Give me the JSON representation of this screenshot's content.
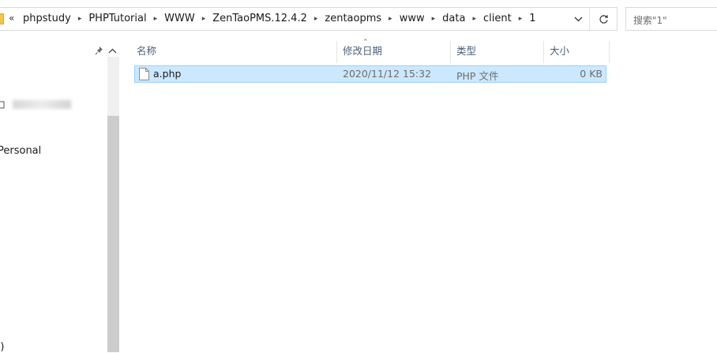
{
  "address_bar": {
    "overflow_label": "«",
    "crumbs": [
      "phpstudy",
      "PHPTutorial",
      "WWW",
      "ZenTaoPMS.12.4.2",
      "zentaopms",
      "www",
      "data",
      "client",
      "1"
    ],
    "dropdown_icon": "chevron-down-icon",
    "refresh_icon": "refresh-icon"
  },
  "search": {
    "placeholder": "搜索\"1\""
  },
  "nav_pane": {
    "items": [
      "Personal",
      ":)"
    ]
  },
  "columns": {
    "name": "名称",
    "modified": "修改日期",
    "type": "类型",
    "size": "大小"
  },
  "files": [
    {
      "name": "a.php",
      "modified": "2020/11/12 15:32",
      "type": "PHP 文件",
      "size": "0 KB",
      "selected": true
    }
  ],
  "colors": {
    "selection_bg": "#cce8ff",
    "selection_border": "#99d1ff",
    "header_text": "#4c607a"
  }
}
